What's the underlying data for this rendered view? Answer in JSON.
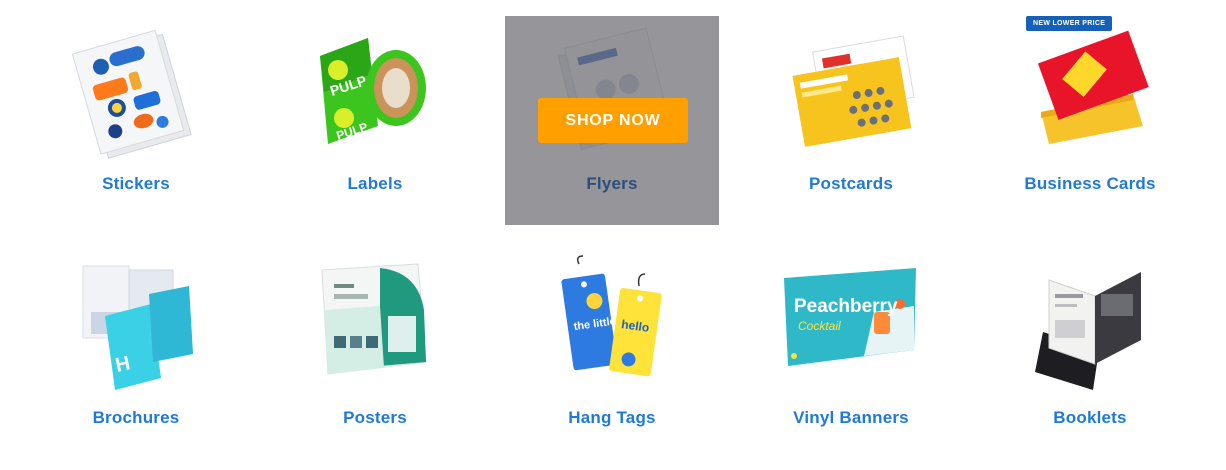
{
  "colors": {
    "label": "#1f7ad6",
    "button": "#ff9f00",
    "badge": "#1560b8"
  },
  "shop_now_label": "SHOP NOW",
  "badge_text": "NEW LOWER PRICE",
  "products": [
    {
      "label": "Stickers",
      "icon": "stickers-icon"
    },
    {
      "label": "Labels",
      "icon": "labels-roll-icon"
    },
    {
      "label": "Flyers",
      "icon": "flyers-icon"
    },
    {
      "label": "Postcards",
      "icon": "postcards-icon"
    },
    {
      "label": "Business Cards",
      "icon": "business-cards-icon"
    },
    {
      "label": "Brochures",
      "icon": "brochures-icon"
    },
    {
      "label": "Posters",
      "icon": "posters-icon"
    },
    {
      "label": "Hang Tags",
      "icon": "hang-tags-icon"
    },
    {
      "label": "Vinyl Banners",
      "icon": "vinyl-banner-icon"
    },
    {
      "label": "Booklets",
      "icon": "booklets-icon"
    }
  ],
  "artwork_text": {
    "labels_brand": "PULP",
    "hang_tag_1": "the little finch",
    "hang_tag_2": "hello",
    "banner_title": "Peachberry",
    "banner_subtitle": "Cocktail"
  }
}
